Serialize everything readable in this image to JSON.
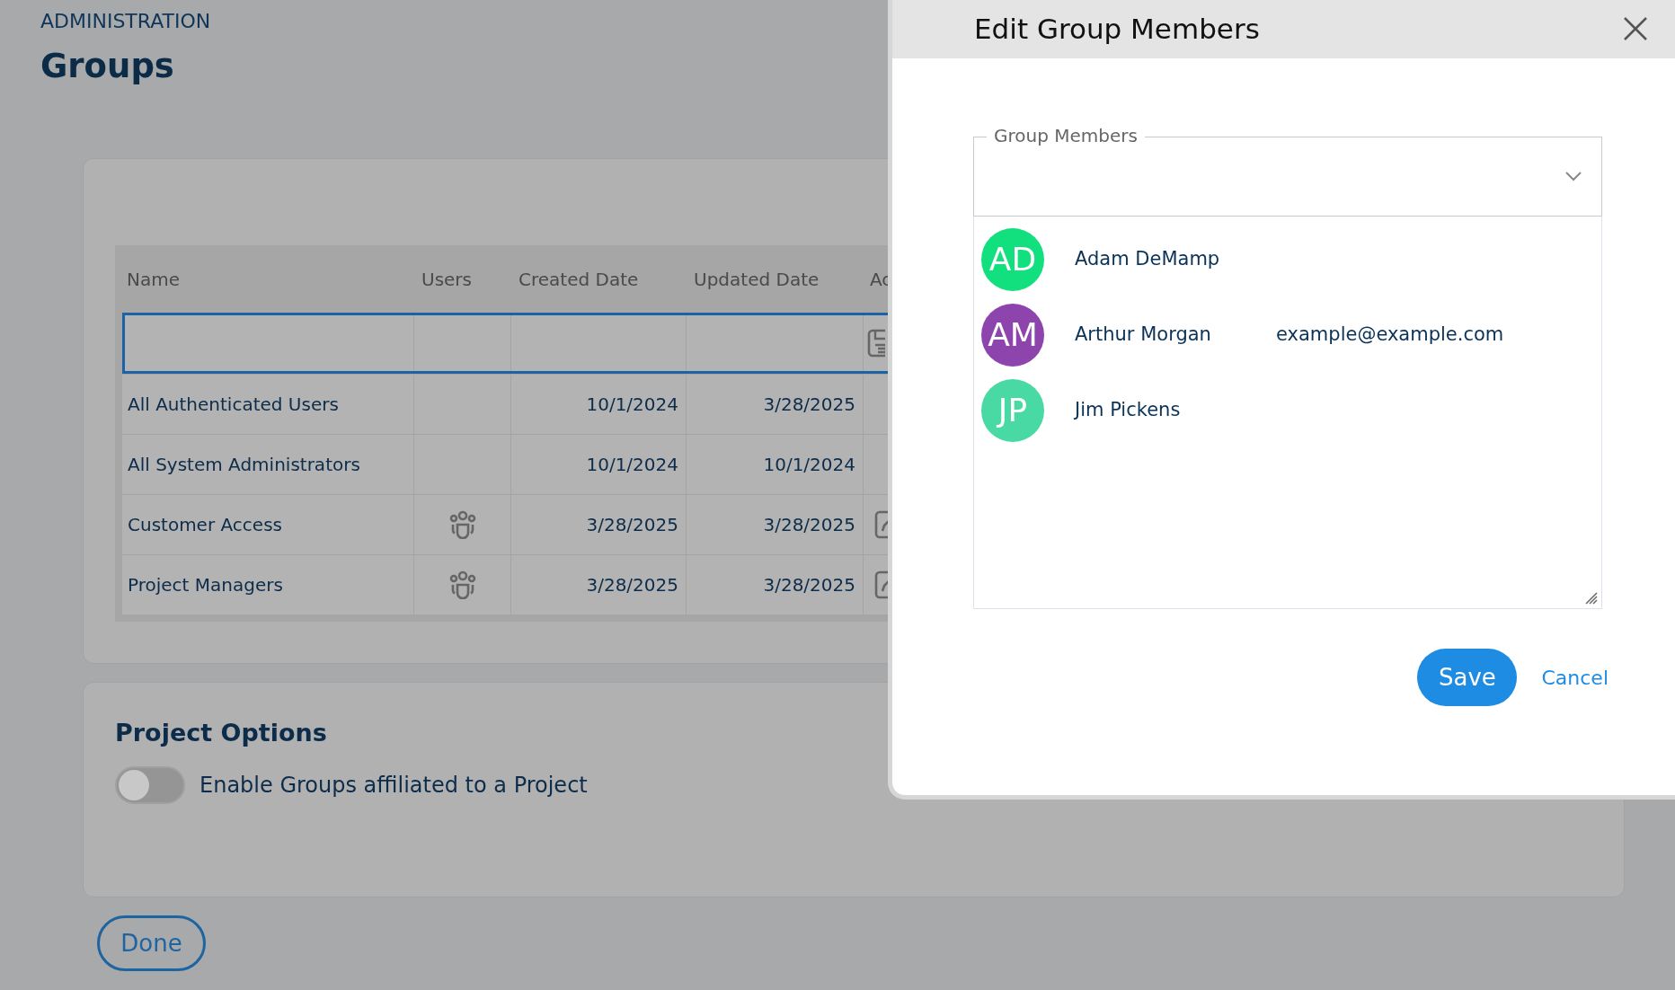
{
  "page": {
    "section": "ADMINISTRATION",
    "title": "Groups"
  },
  "table": {
    "columns": [
      "Name",
      "Users",
      "Created Date",
      "Updated Date",
      "Ac"
    ],
    "edit_row": true,
    "rows": [
      {
        "name": "All Authenticated Users",
        "users_icon": false,
        "created": "10/1/2024",
        "updated": "3/28/2025",
        "edit_icon": false
      },
      {
        "name": "All System Administrators",
        "users_icon": false,
        "created": "10/1/2024",
        "updated": "10/1/2024",
        "edit_icon": false
      },
      {
        "name": "Customer Access",
        "users_icon": true,
        "created": "3/28/2025",
        "updated": "3/28/2025",
        "edit_icon": true
      },
      {
        "name": "Project Managers",
        "users_icon": true,
        "created": "3/28/2025",
        "updated": "3/28/2025",
        "edit_icon": true
      }
    ]
  },
  "project_options": {
    "title": "Project Options",
    "toggle": {
      "label": "Enable Groups affiliated to a Project",
      "on": false
    }
  },
  "done_button": "Done",
  "dialog": {
    "title": "Edit Group Members",
    "field": {
      "legend": "Group Members"
    },
    "members": [
      {
        "initials": "AD",
        "name": "Adam DeMamp",
        "color": "#12e07f"
      },
      {
        "initials": "AM",
        "name": "Arthur Morgan",
        "email": "example@example.com",
        "color": "#8e44ad"
      },
      {
        "initials": "JP",
        "name": "Jim Pickens",
        "color": "#48d9a4"
      }
    ],
    "save": "Save",
    "cancel": "Cancel"
  }
}
